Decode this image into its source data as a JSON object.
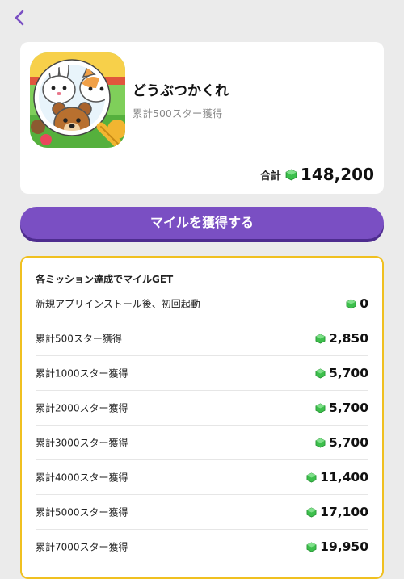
{
  "app": {
    "name": "どうぶつかくれ",
    "subtitle": "累計500スター獲得",
    "total_label": "合計",
    "total_value": "148,200"
  },
  "cta": {
    "label": "マイルを獲得する"
  },
  "missions": {
    "title": "各ミッション達成でマイルGET",
    "items": [
      {
        "label": "新規アプリインストール後、初回起動",
        "reward": "0"
      },
      {
        "label": "累計500スター獲得",
        "reward": "2,850"
      },
      {
        "label": "累計1000スター獲得",
        "reward": "5,700"
      },
      {
        "label": "累計2000スター獲得",
        "reward": "5,700"
      },
      {
        "label": "累計3000スター獲得",
        "reward": "5,700"
      },
      {
        "label": "累計4000スター獲得",
        "reward": "11,400"
      },
      {
        "label": "累計5000スター獲得",
        "reward": "17,100"
      },
      {
        "label": "累計7000スター獲得",
        "reward": "19,950"
      }
    ]
  },
  "colors": {
    "accent": "#7a4fc3",
    "accent_shadow": "#4e2c8f",
    "card_border": "#f0c020",
    "gem": "#3dbf4c",
    "background": "#ebebeb"
  },
  "icons": {
    "back": "chevron-left-icon",
    "gem": "green-gem-icon"
  }
}
